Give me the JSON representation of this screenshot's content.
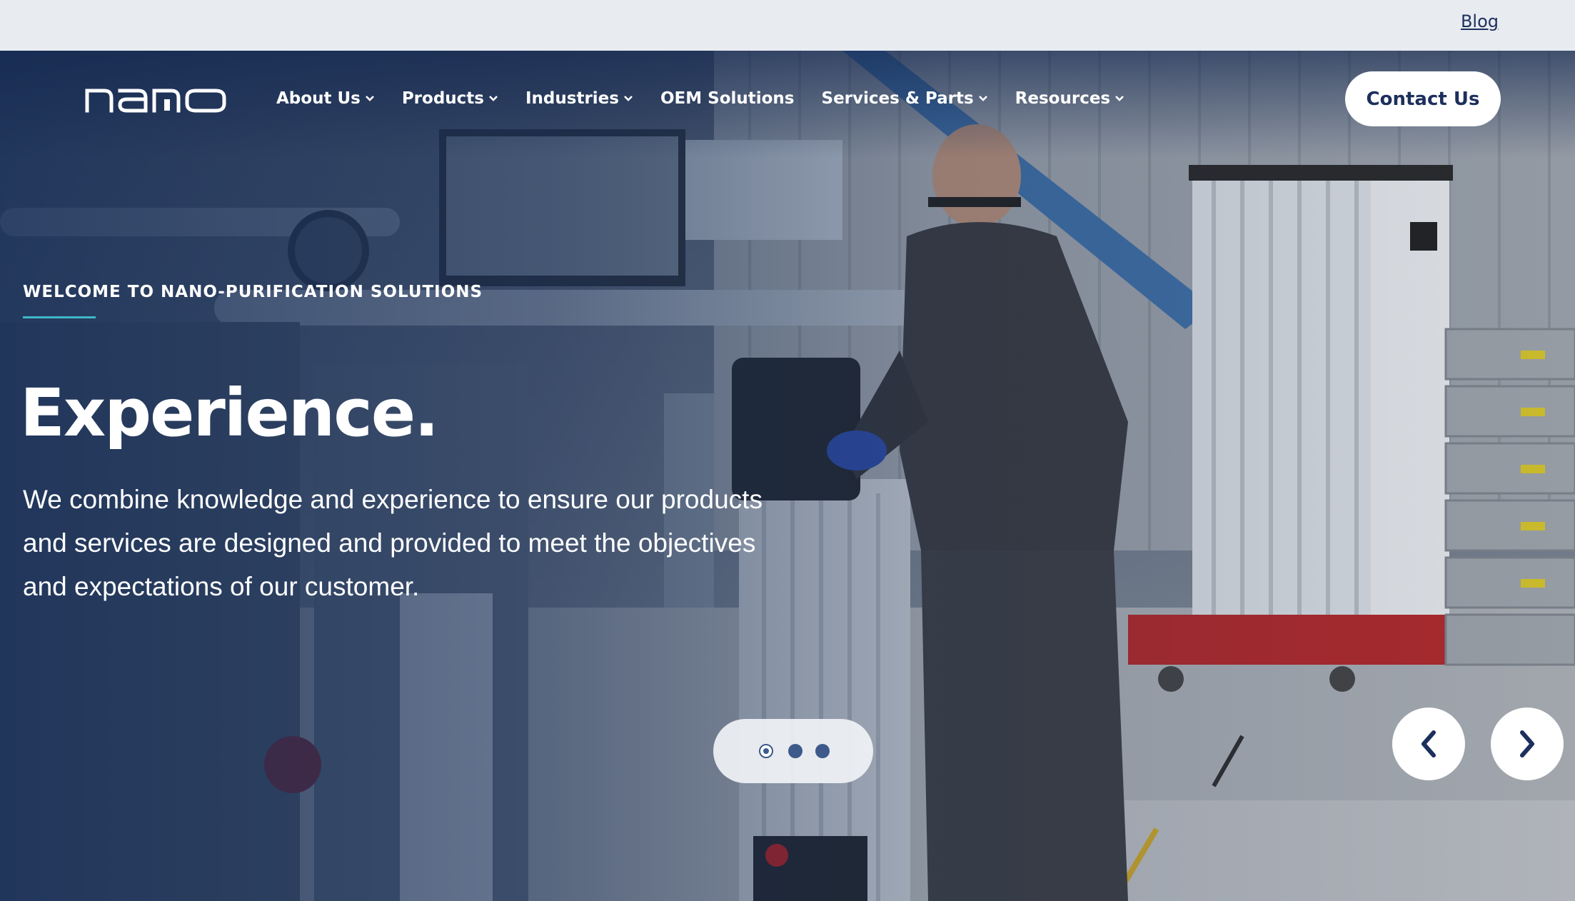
{
  "utility": {
    "blog_label": "Blog"
  },
  "brand": {
    "logo_text": "nano"
  },
  "nav": {
    "items": [
      {
        "label": "About Us",
        "has_dropdown": true
      },
      {
        "label": "Products",
        "has_dropdown": true
      },
      {
        "label": "Industries",
        "has_dropdown": true
      },
      {
        "label": "OEM Solutions",
        "has_dropdown": false
      },
      {
        "label": "Services & Parts",
        "has_dropdown": true
      },
      {
        "label": "Resources",
        "has_dropdown": true
      }
    ],
    "cta_label": "Contact Us"
  },
  "hero": {
    "eyebrow": "WELCOME TO NANO-PURIFICATION SOLUTIONS",
    "headline": "Experience.",
    "lead": "We combine knowledge and experience to ensure our products and services are designed and provided to meet the objectives and expectations of our customer.",
    "slides_total": 3,
    "active_slide": 1
  },
  "icons": {
    "chevron_down": "chevron-down-icon",
    "prev": "chevron-left-icon",
    "next": "chevron-right-icon"
  },
  "colors": {
    "brand_navy": "#1d2f5c",
    "accent_teal": "#3fb7c7",
    "utility_bg": "#e8ecf1",
    "white": "#ffffff"
  }
}
